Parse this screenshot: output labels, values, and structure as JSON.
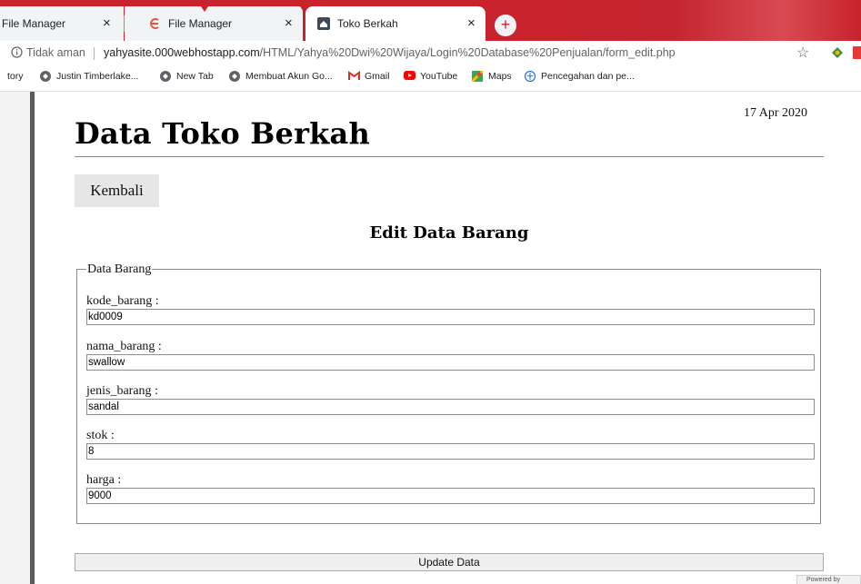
{
  "browser": {
    "tabs": [
      {
        "title": "File Manager",
        "active": false
      },
      {
        "title": "File Manager",
        "active": false
      },
      {
        "title": "Toko Berkah",
        "active": true
      }
    ],
    "tab_close_glyph": "×",
    "new_tab_glyph": "+",
    "security_label": "Tidak aman",
    "url_host": "yahyasite.000webhostapp.com",
    "url_path": "/HTML/Yahya%20Dwi%20Wijaya/Login%20Database%20Penjualan/form_edit.php",
    "star_glyph": "☆",
    "bookmarks": [
      {
        "label": "tory",
        "icon": "none"
      },
      {
        "label": "Justin Timberlake...",
        "icon": "globe-icon"
      },
      {
        "label": "New Tab",
        "icon": "globe-icon"
      },
      {
        "label": "Membuat Akun Go...",
        "icon": "globe-icon"
      },
      {
        "label": "Gmail",
        "icon": "gmail-icon"
      },
      {
        "label": "YouTube",
        "icon": "youtube-icon"
      },
      {
        "label": "Maps",
        "icon": "maps-icon"
      },
      {
        "label": "Pencegahan dan pe...",
        "icon": "who-icon"
      }
    ],
    "accent": "#c8232c"
  },
  "page": {
    "date": "17 Apr 2020",
    "title": "Data Toko Berkah",
    "back_label": "Kembali",
    "form_title": "Edit Data Barang",
    "legend": "Data Barang",
    "fields": [
      {
        "label": "kode_barang :",
        "value": "kd0009"
      },
      {
        "label": "nama_barang :",
        "value": "swallow"
      },
      {
        "label": "jenis_barang :",
        "value": "sandal"
      },
      {
        "label": "stok :",
        "value": "8"
      },
      {
        "label": "harga :",
        "value": "9000"
      }
    ],
    "submit_label": "Update Data",
    "corner_text": "Powered by"
  }
}
